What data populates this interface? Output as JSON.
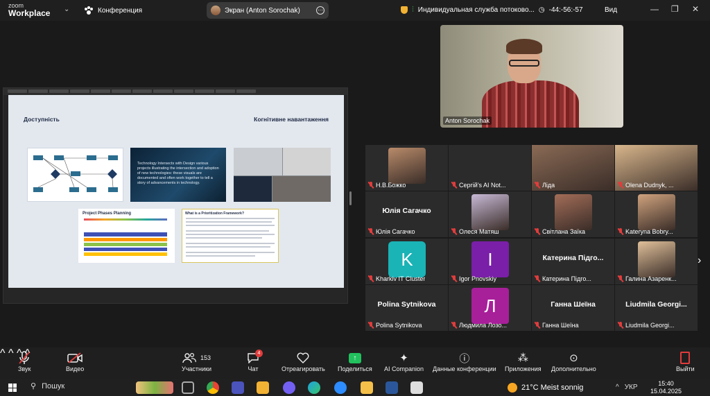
{
  "app": {
    "logo_top": "zoom",
    "logo_bottom": "Workplace",
    "meeting_title": "Конференция"
  },
  "screen_share": {
    "label": "Экран (Anton Sorochak)"
  },
  "status": {
    "service": "Индивидуальная служба потоково...",
    "timer": "-44:-56:-57",
    "view_label": "Вид"
  },
  "slide": {
    "heading_left": "Доступність",
    "heading_right": "Когнітивне навантаження",
    "img2_text": "Technology Intersects with Design various projects illustrating the intersection and adoption of new technologies: these visuals are documented and often work together to tell a story of advancements in technology.",
    "img4_title": "Project Phases Planning",
    "img5_title": "What is a Prioritization Framework?"
  },
  "speaker": {
    "name": "Anton Sorochak"
  },
  "participants": [
    {
      "label": "Н.В.Божко",
      "big": "",
      "kind": "photo",
      "color": "#b98b6a"
    },
    {
      "label": "Сергій's AI Not...",
      "big": "",
      "kind": "dark",
      "color": "#2e2e2e"
    },
    {
      "label": "Ліда",
      "big": "",
      "kind": "photo",
      "color": "#8a6a55"
    },
    {
      "label": "Olena Dudnyk, ...",
      "big": "",
      "kind": "photo",
      "color": "#d8b68c"
    },
    {
      "label": "Юлія Сагачко",
      "big": "Юлія Сагачко",
      "kind": "name",
      "color": ""
    },
    {
      "label": "Олеся Матяш",
      "big": "",
      "kind": "photo",
      "color": "#c8b9d6"
    },
    {
      "label": "Світлана Заїка",
      "big": "",
      "kind": "photo",
      "color": "#a36d58"
    },
    {
      "label": "Kateryna Bobry...",
      "big": "",
      "kind": "photo",
      "color": "#d0a37e"
    },
    {
      "label": "Kharkiv IT Cluster",
      "big": "K",
      "kind": "logo",
      "color": "#1ab3b6"
    },
    {
      "label": "Igor Pnovskiy",
      "big": "I",
      "kind": "letter",
      "color": "#7a1fa8"
    },
    {
      "label": "Катерина Підго...",
      "big": "Катерина Підго...",
      "kind": "name",
      "color": ""
    },
    {
      "label": "Галина Азаренк...",
      "big": "",
      "kind": "photo",
      "color": "#e0c09a"
    },
    {
      "label": "Polina Sytnikova",
      "big": "Polina Sytnikova",
      "kind": "name",
      "color": ""
    },
    {
      "label": "Людмила Лозо...",
      "big": "Л",
      "kind": "letter",
      "color": "#a81f9a"
    },
    {
      "label": "Ганна Шеїна",
      "big": "Ганна Шеїна",
      "kind": "name",
      "color": ""
    },
    {
      "label": "Liudmila Georgi...",
      "big": "Liudmila Georgi...",
      "kind": "name",
      "color": ""
    }
  ],
  "toolbar": {
    "audio": "Звук",
    "video": "Видео",
    "participants": "Участники",
    "participants_count": "153",
    "chat": "Чат",
    "chat_badge": "4",
    "react": "Отреагировать",
    "share": "Поделиться",
    "ai": "AI Companion",
    "info": "Данные конференции",
    "apps": "Приложения",
    "more": "Дополнительно",
    "leave": "Выйти"
  },
  "taskbar": {
    "search": "Пошук",
    "weather": "21°C  Meist sonnig",
    "lang": "УКР",
    "time": "15:40",
    "date": "15.04.2025"
  },
  "colors": {
    "accent_green": "#22c15e",
    "mute_red": "#e23c3c",
    "background": "#1a1a1a"
  }
}
